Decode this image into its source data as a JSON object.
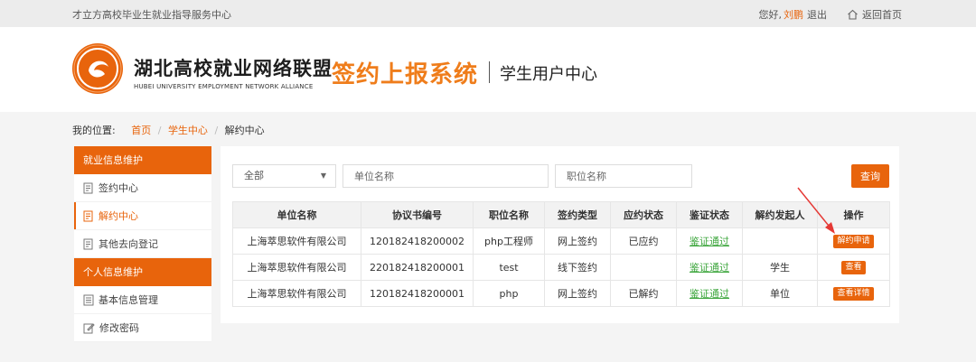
{
  "topbar": {
    "site_name": "才立方高校毕业生就业指导服务中心",
    "greeting": "您好,",
    "user_name": "刘鹏",
    "logout": "退出",
    "home": "返回首页"
  },
  "header": {
    "brand_cn": "湖北高校就业网络联盟",
    "brand_en": "HUBEI UNIVERSITY EMPLOYMENT NETWORK ALLIANCE",
    "system_title": "签约上报系统",
    "sub_title": "学生用户中心"
  },
  "breadcrumb": {
    "label": "我的位置:",
    "home": "首页",
    "center": "学生中心",
    "current": "解约中心",
    "sep": "/"
  },
  "sidebar": {
    "group1": "就业信息维护",
    "items1": [
      "签约中心",
      "解约中心",
      "其他去向登记"
    ],
    "group2": "个人信息维护",
    "items2": [
      "基本信息管理",
      "修改密码"
    ]
  },
  "search": {
    "filter_value": "全部",
    "company_placeholder": "单位名称",
    "position_placeholder": "职位名称",
    "query": "查询"
  },
  "table": {
    "headers": [
      "单位名称",
      "协议书编号",
      "职位名称",
      "签约类型",
      "应约状态",
      "鉴证状态",
      "解约发起人",
      "操作"
    ],
    "rows": [
      [
        "上海萃思软件有限公司",
        "120182418200002",
        "php工程师",
        "网上签约",
        "已应约",
        "鉴证通过",
        "",
        "解约申请"
      ],
      [
        "上海萃思软件有限公司",
        "220182418200001",
        "test",
        "线下签约",
        "",
        "鉴证通过",
        "学生",
        "查看"
      ],
      [
        "上海萃思软件有限公司",
        "120182418200001",
        "php",
        "网上签约",
        "已解约",
        "鉴证通过",
        "单位",
        "查看详情"
      ]
    ]
  },
  "colors": {
    "accent": "#e8640c",
    "title_orange": "#ef7d1b",
    "status_green": "#3fa73f"
  }
}
